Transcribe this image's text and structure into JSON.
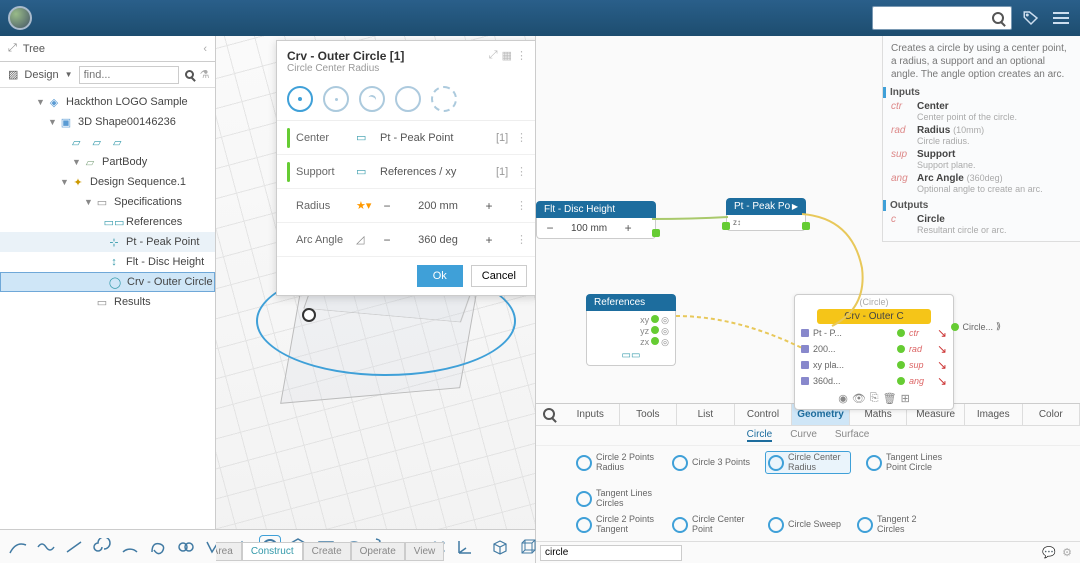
{
  "topbar": {
    "search_placeholder": ""
  },
  "tree": {
    "header": "Tree",
    "design_label": "Design",
    "find_placeholder": "find...",
    "items": [
      {
        "label": "Hackthon LOGO Sample",
        "indent": 36
      },
      {
        "label": "3D Shape00146236",
        "indent": 48
      },
      {
        "label": "PartBody",
        "indent": 72
      },
      {
        "label": "Design Sequence.1",
        "indent": 60
      },
      {
        "label": "Specifications",
        "indent": 84
      },
      {
        "label": "References",
        "indent": 96
      },
      {
        "label": "Pt - Peak Point",
        "indent": 96,
        "selectedSoft": true
      },
      {
        "label": "Flt - Disc Height",
        "indent": 96
      },
      {
        "label": "Crv - Outer Circle",
        "indent": 96,
        "selected": true
      },
      {
        "label": "Results",
        "indent": 84
      }
    ]
  },
  "dialog": {
    "title": "Crv - Outer Circle [1]",
    "subtitle": "Circle Center Radius",
    "props": [
      {
        "label": "Center",
        "value": "Pt - Peak Point",
        "count": "[1]",
        "bar": true
      },
      {
        "label": "Support",
        "value": "References / xy",
        "count": "[1]",
        "bar": true
      },
      {
        "label": "Radius",
        "value": "200 mm",
        "star": true,
        "stepper": true
      },
      {
        "label": "Arc Angle",
        "value": "360 deg",
        "stepper": true
      }
    ],
    "ok": "Ok",
    "cancel": "Cancel"
  },
  "viewport_tabs": [
    "Fixed Area",
    "Construct",
    "Create",
    "Operate",
    "View"
  ],
  "viewport_tabs_active": 1,
  "graph": {
    "node_height": {
      "title": "Flt - Disc Height",
      "value": "100 mm"
    },
    "node_peak": {
      "title": "Pt - Peak Po"
    },
    "refs": {
      "title": "References",
      "ports": [
        "xy",
        "yz",
        "zx"
      ]
    },
    "circle": {
      "group": "(Circle)",
      "title": "Crv - Outer C",
      "rows": [
        {
          "left": "Pt - P...",
          "tag": "ctr"
        },
        {
          "left": "200...",
          "tag": "rad"
        },
        {
          "left": "xy pla...",
          "tag": "sup"
        },
        {
          "left": "360d...",
          "tag": "ang"
        }
      ],
      "output": "Circle..."
    }
  },
  "help": {
    "desc": "Creates a circle by using a center point, a radius, a support and an optional angle. The angle option creates an arc.",
    "inputs_label": "Inputs",
    "outputs_label": "Outputs",
    "inputs": [
      {
        "tag": "ctr",
        "label": "Center",
        "sub": "Center point of the circle."
      },
      {
        "tag": "rad",
        "label": "Radius",
        "hint": "(10mm)",
        "sub": "Circle radius."
      },
      {
        "tag": "sup",
        "label": "Support",
        "sub": "Support plane."
      },
      {
        "tag": "ang",
        "label": "Arc Angle",
        "hint": "(360deg)",
        "sub": "Optional angle to create an arc."
      }
    ],
    "outputs": [
      {
        "tag": "c",
        "label": "Circle",
        "sub": "Resultant circle or arc."
      }
    ]
  },
  "right_tabs": [
    "Inputs",
    "Tools",
    "List",
    "Control",
    "Geometry",
    "Maths",
    "Measure",
    "Images",
    "Color"
  ],
  "right_tabs_active": 4,
  "subtabs": [
    "Circle",
    "Curve",
    "Surface"
  ],
  "subtabs_active": 0,
  "tools": {
    "row1": [
      {
        "label": "Circle 2 Points Radius"
      },
      {
        "label": "Circle 3 Points"
      },
      {
        "label": "Circle Center Radius",
        "active": true
      },
      {
        "label": "Tangent Lines Point Circle"
      },
      {
        "label": "Tangent Lines Circles"
      }
    ],
    "row2": [
      {
        "label": "Circle 2 Points Tangent"
      },
      {
        "label": "Circle Center Point"
      },
      {
        "label": "Circle Sweep"
      },
      {
        "label": "Tangent 2 Circles"
      }
    ]
  },
  "filter": "circle"
}
